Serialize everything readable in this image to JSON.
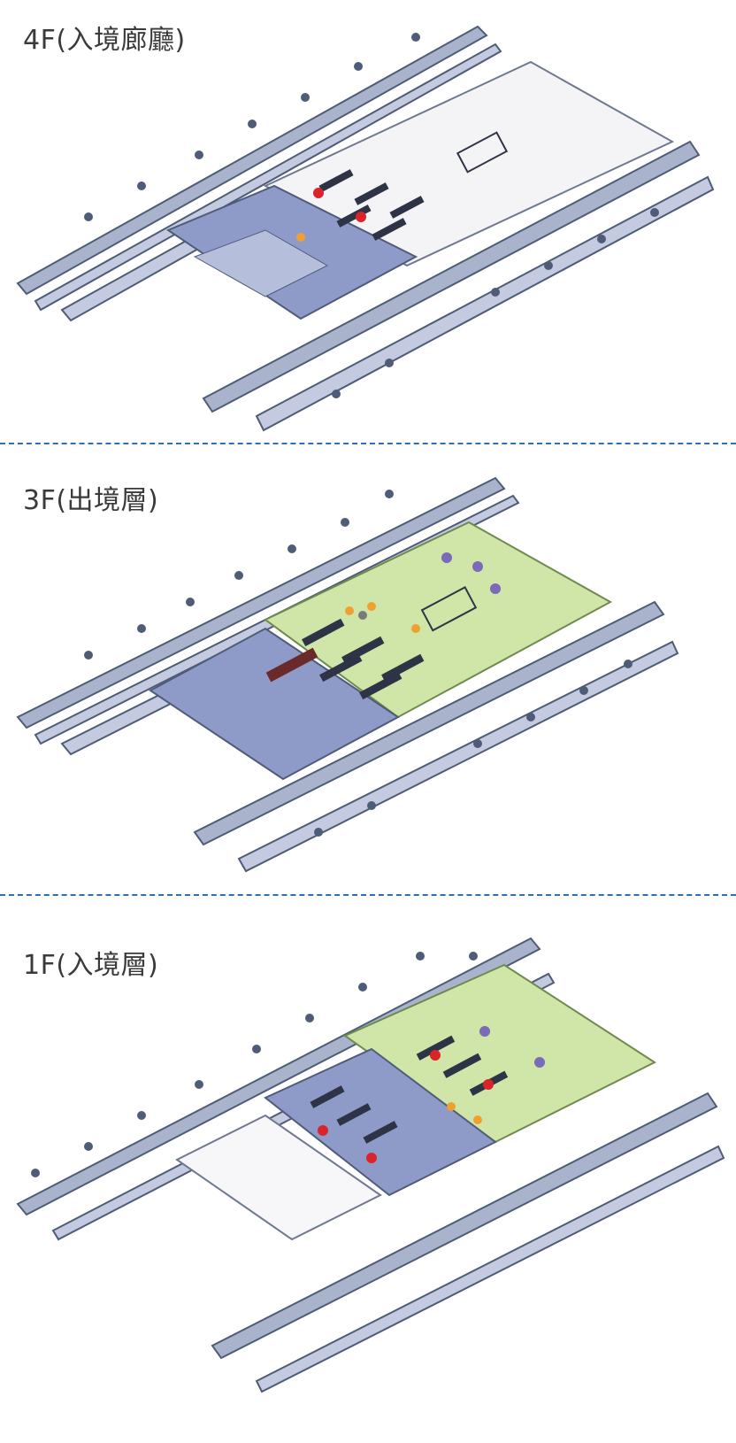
{
  "floors": [
    {
      "label": "4F(入境廊廳)"
    },
    {
      "label": "3F(出境層)"
    },
    {
      "label": "1F(入境層)"
    }
  ],
  "colors": {
    "steel": "#4f5c78",
    "steel_light": "#a9b4cc",
    "blue_fill": "#8e9bc9",
    "green_fill": "#cfe6a8",
    "divider": "#2f6fb5",
    "marker_red": "#d9252a",
    "marker_orange": "#f0a030",
    "marker_purple": "#7a6ab8"
  },
  "icons": [
    "gate-stand-icon",
    "marker-pin-icon"
  ]
}
